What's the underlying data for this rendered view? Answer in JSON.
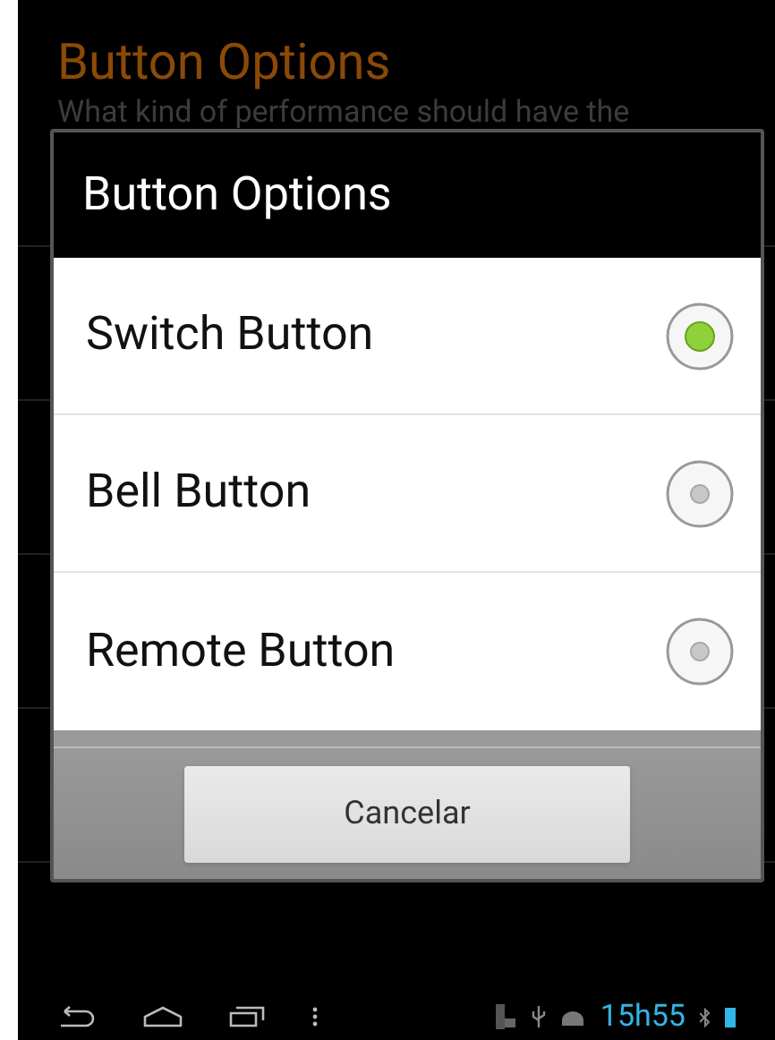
{
  "background": {
    "title": "Button Options",
    "subtitle": "What kind of performance should have the"
  },
  "dialog": {
    "title": "Button Options",
    "options": [
      {
        "label": "Switch Button",
        "selected": true
      },
      {
        "label": "Bell Button",
        "selected": false
      },
      {
        "label": "Remote Button",
        "selected": false
      }
    ],
    "cancel_button": "Cancelar"
  },
  "status_bar": {
    "time": "15h55"
  }
}
